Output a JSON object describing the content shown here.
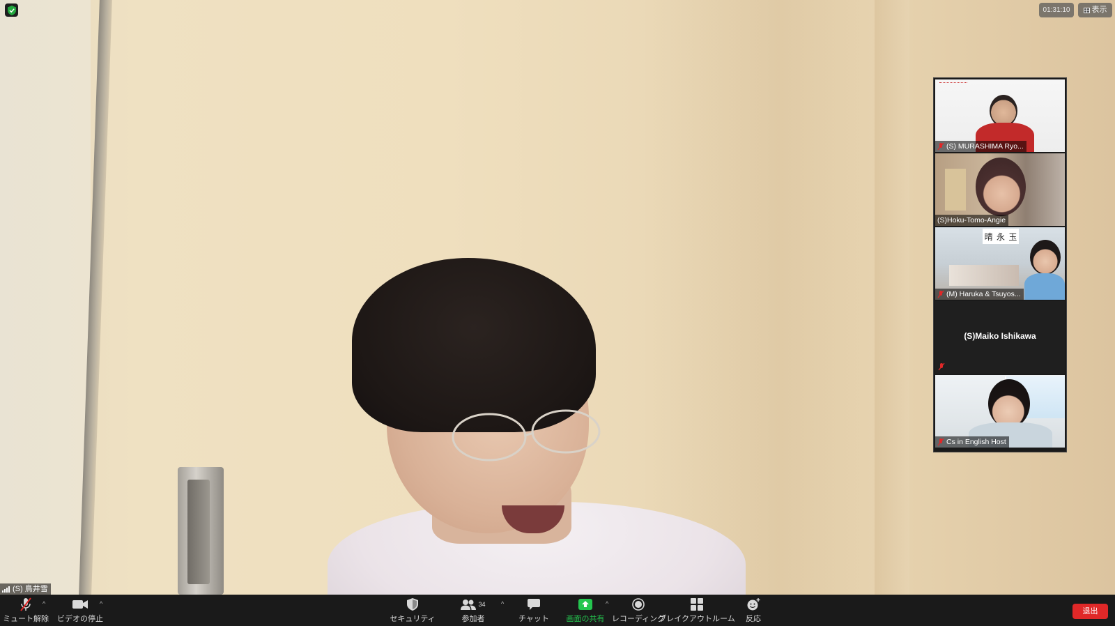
{
  "meeting": {
    "elapsed_time": "01:31:10",
    "view_button_label": "表示",
    "security_status": "encrypted"
  },
  "main_speaker": {
    "label": "(S) 鳥井雪",
    "muted": false
  },
  "gallery": {
    "tiles": [
      {
        "name": "(S) MURASHIMA Ryo...",
        "muted": true,
        "video": true
      },
      {
        "name": "(S)Hoku-Tomo-Angie",
        "muted": false,
        "video": true
      },
      {
        "name": "(M) Haruka & Tsuyos...",
        "muted": true,
        "video": true
      },
      {
        "name": "(S)Maiko Ishikawa",
        "muted": true,
        "video": false
      },
      {
        "name": "Cs in English Host",
        "muted": true,
        "video": true
      }
    ],
    "tile3_sign_chars": [
      "晴",
      "永",
      "玉"
    ]
  },
  "toolbar": {
    "unmute_label": "ミュート解除",
    "stop_video_label": "ビデオの停止",
    "security_label": "セキュリティ",
    "participants_label": "参加者",
    "participants_count": "34",
    "chat_label": "チャット",
    "share_screen_label": "画面の共有",
    "recording_label": "レコーディング",
    "breakout_label": "ブレイクアウトルーム",
    "reactions_label": "反応",
    "leave_label": "退出"
  },
  "colors": {
    "toolbar_bg": "#1a1a1a",
    "share_green": "#24c54f",
    "leave_red": "#e02828",
    "muted_red": "#e02828",
    "shield_green": "#23a83e"
  },
  "icons": {
    "shield": "shield-check-icon",
    "mic_muted": "mic-off-icon",
    "video": "video-camera-icon",
    "security": "shield-icon",
    "participants": "people-icon",
    "chat": "chat-bubble-icon",
    "share": "share-up-arrow-icon",
    "record": "record-circle-icon",
    "breakout": "grid-four-icon",
    "reactions": "smiley-plus-icon",
    "view": "grid-view-icon"
  }
}
